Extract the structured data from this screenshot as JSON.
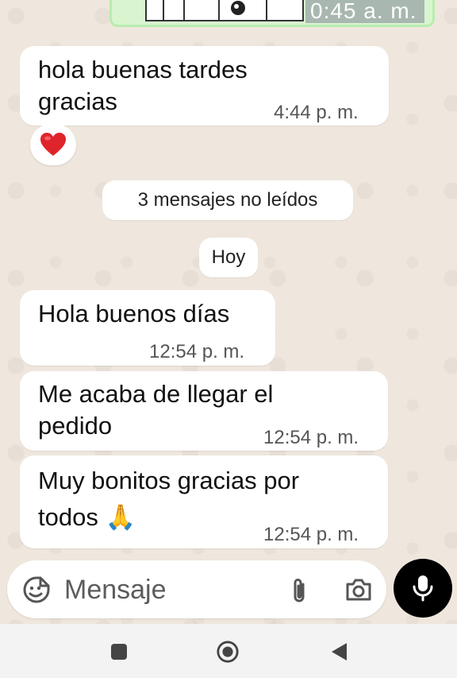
{
  "status_strip": {
    "time_text": "0:45 a. m."
  },
  "messages": [
    {
      "text": "hola buenas tardes\ngracias",
      "time": "4:44 p. m."
    },
    {
      "text": "Hola buenos días",
      "time": "12:54 p. m."
    },
    {
      "text": "Me acaba de llegar el\npedido",
      "time": "12:54 p. m."
    },
    {
      "text": "Muy bonitos gracias por\ntodos 🙏",
      "time": "12:54 p. m."
    }
  ],
  "reaction": {
    "emoji": "❤️"
  },
  "unread_banner": "3 mensajes no leídos",
  "date_chip": "Hoy",
  "composer": {
    "placeholder": "Mensaje",
    "icons": [
      "sticker-icon",
      "attach-icon",
      "camera-icon",
      "mic-icon"
    ]
  },
  "navbar": {
    "icons": [
      "recents-icon",
      "home-icon",
      "back-icon"
    ]
  },
  "colors": {
    "chat_background": "#efe7dd",
    "bubble": "#ffffff",
    "mic_button": "#000000"
  }
}
